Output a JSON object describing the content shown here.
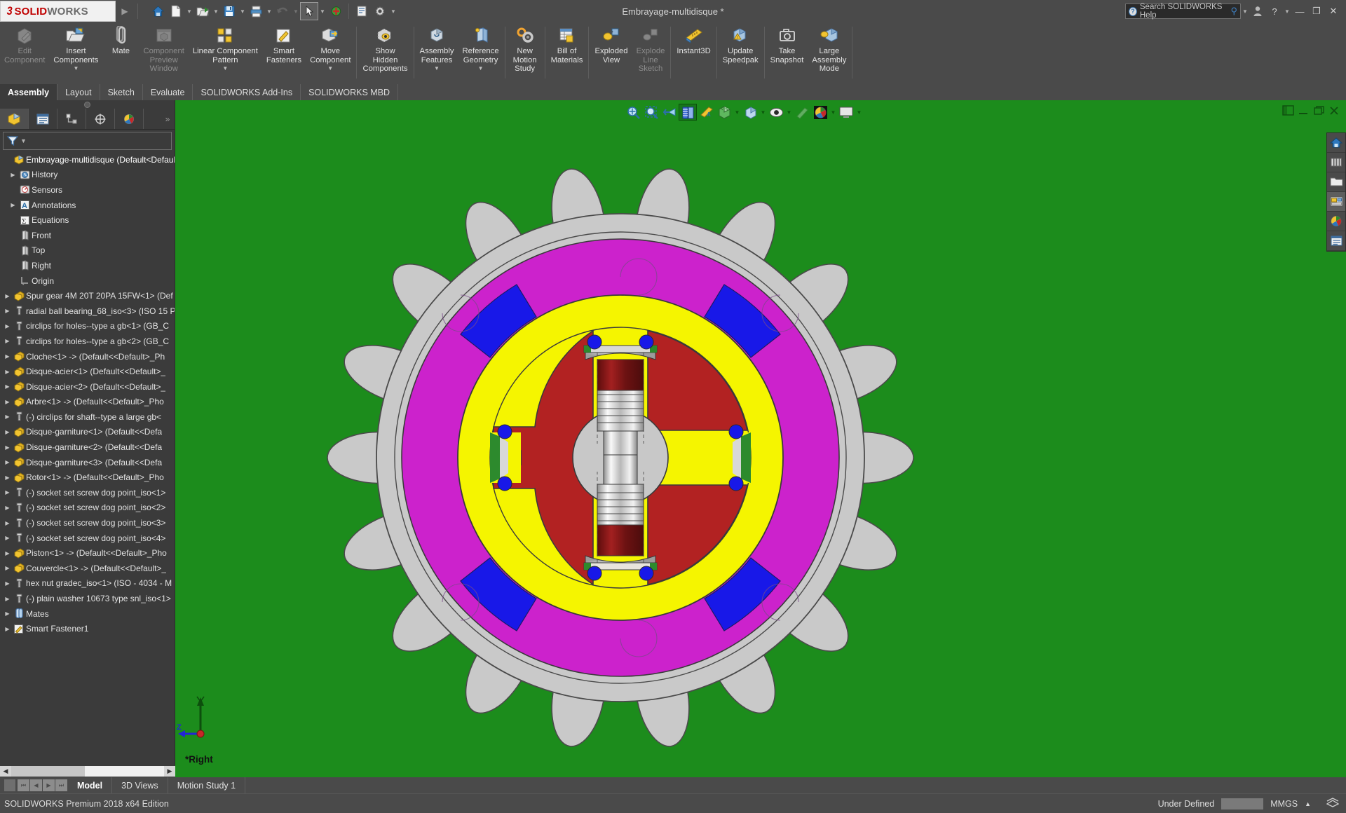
{
  "app": {
    "brand_ds": "3DS",
    "brand_solid": "SOLID",
    "brand_works": "WORKS",
    "title": "Embrayage-multidisque *",
    "edition": "SOLIDWORKS Premium 2018 x64 Edition"
  },
  "colors": {
    "viewport_green": "#1c8c1c",
    "ribbon_gray": "#4a4a4a",
    "panel_gray": "#3b3b3b",
    "accent_red": "#c00000",
    "model_magenta": "#cc22cc",
    "model_yellow": "#f5f500",
    "model_blue": "#1818e8",
    "model_red": "#b22222",
    "model_gray": "#c8c8c8",
    "model_green": "#1c8c1c"
  },
  "search": {
    "placeholder": "Search SOLIDWORKS Help",
    "value": ""
  },
  "window_controls": {
    "minimize": "—",
    "restore": "❐",
    "close": "✕",
    "help": "?",
    "profile": "user-icon"
  },
  "quick_access": [
    {
      "name": "home-icon",
      "label": "Home",
      "dropdown": false,
      "disabled": false
    },
    {
      "name": "new-document-icon",
      "label": "New",
      "dropdown": true,
      "disabled": false
    },
    {
      "name": "open-folder-icon",
      "label": "Open",
      "dropdown": true,
      "disabled": false
    },
    {
      "name": "save-icon",
      "label": "Save",
      "dropdown": true,
      "disabled": false
    },
    {
      "name": "print-icon",
      "label": "Print",
      "dropdown": true,
      "disabled": false
    },
    {
      "name": "undo-icon",
      "label": "Undo",
      "dropdown": true,
      "disabled": true
    },
    {
      "name": "select-arrow-icon",
      "label": "Select",
      "dropdown": true,
      "disabled": false,
      "selected": true
    },
    {
      "name": "rebuild-icon",
      "label": "Rebuild",
      "dropdown": false,
      "disabled": false
    },
    {
      "name": "file-properties-icon",
      "label": "File Properties",
      "dropdown": false,
      "disabled": false
    },
    {
      "name": "options-gear-icon",
      "label": "Options",
      "dropdown": true,
      "disabled": false
    }
  ],
  "ribbon": {
    "buttons": [
      {
        "label": "Edit\nComponent",
        "icon": "edit-component-icon",
        "disabled": true,
        "dropdown": false,
        "sep_after": false
      },
      {
        "label": "Insert\nComponents",
        "icon": "insert-components-icon",
        "disabled": false,
        "dropdown": true,
        "sep_after": false
      },
      {
        "label": "Mate",
        "icon": "mate-icon",
        "disabled": false,
        "dropdown": false,
        "sep_after": false
      },
      {
        "label": "Component\nPreview\nWindow",
        "icon": "component-preview-window-icon",
        "disabled": true,
        "dropdown": false,
        "sep_after": false
      },
      {
        "label": "Linear Component\nPattern",
        "icon": "linear-component-pattern-icon",
        "disabled": false,
        "dropdown": true,
        "sep_after": false
      },
      {
        "label": "Smart\nFasteners",
        "icon": "smart-fasteners-icon",
        "disabled": false,
        "dropdown": false,
        "sep_after": false
      },
      {
        "label": "Move\nComponent",
        "icon": "move-component-icon",
        "disabled": false,
        "dropdown": true,
        "sep_after": true
      },
      {
        "label": "Show\nHidden\nComponents",
        "icon": "show-hidden-components-icon",
        "disabled": false,
        "dropdown": false,
        "sep_after": true
      },
      {
        "label": "Assembly\nFeatures",
        "icon": "assembly-features-icon",
        "disabled": false,
        "dropdown": true,
        "sep_after": false
      },
      {
        "label": "Reference\nGeometry",
        "icon": "reference-geometry-icon",
        "disabled": false,
        "dropdown": true,
        "sep_after": true
      },
      {
        "label": "New\nMotion\nStudy",
        "icon": "new-motion-study-icon",
        "disabled": false,
        "dropdown": false,
        "sep_after": true
      },
      {
        "label": "Bill of\nMaterials",
        "icon": "bill-of-materials-icon",
        "disabled": false,
        "dropdown": false,
        "sep_after": true
      },
      {
        "label": "Exploded\nView",
        "icon": "exploded-view-icon",
        "disabled": false,
        "dropdown": false,
        "sep_after": false
      },
      {
        "label": "Explode\nLine\nSketch",
        "icon": "explode-line-sketch-icon",
        "disabled": true,
        "dropdown": false,
        "sep_after": true
      },
      {
        "label": "Instant3D",
        "icon": "instant3d-icon",
        "disabled": false,
        "dropdown": false,
        "sep_after": true
      },
      {
        "label": "Update\nSpeedpak",
        "icon": "update-speedpak-icon",
        "disabled": false,
        "dropdown": false,
        "sep_after": true
      },
      {
        "label": "Take\nSnapshot",
        "icon": "take-snapshot-icon",
        "disabled": false,
        "dropdown": false,
        "sep_after": false
      },
      {
        "label": "Large\nAssembly\nMode",
        "icon": "large-assembly-mode-icon",
        "disabled": false,
        "dropdown": false,
        "sep_after": true
      }
    ]
  },
  "command_tabs": [
    {
      "label": "Assembly",
      "active": true
    },
    {
      "label": "Layout",
      "active": false
    },
    {
      "label": "Sketch",
      "active": false
    },
    {
      "label": "Evaluate",
      "active": false
    },
    {
      "label": "SOLIDWORKS Add-Ins",
      "active": false
    },
    {
      "label": "SOLIDWORKS MBD",
      "active": false
    }
  ],
  "left_panel": {
    "tabs": [
      {
        "name": "feature-manager-tab",
        "icon": "yellow-cube-icon",
        "active": true
      },
      {
        "name": "property-manager-tab",
        "icon": "property-list-icon",
        "active": false
      },
      {
        "name": "configuration-manager-tab",
        "icon": "configuration-icon",
        "active": false
      },
      {
        "name": "dimxpert-manager-tab",
        "icon": "dimxpert-icon",
        "active": false
      },
      {
        "name": "display-manager-tab",
        "icon": "appearance-sphere-icon",
        "active": false
      }
    ],
    "filter_placeholder": "",
    "tree": [
      {
        "label": "Embrayage-multidisque  (Default<Default_",
        "icon": "assembly-icon",
        "expand": false,
        "indent": 0,
        "root": true
      },
      {
        "label": "History",
        "icon": "history-icon",
        "expand": true,
        "indent": 1
      },
      {
        "label": "Sensors",
        "icon": "sensors-icon",
        "expand": false,
        "indent": 1
      },
      {
        "label": "Annotations",
        "icon": "annotations-icon",
        "expand": true,
        "indent": 1
      },
      {
        "label": "Equations",
        "icon": "equations-icon",
        "expand": false,
        "indent": 1
      },
      {
        "label": "Front",
        "icon": "plane-icon",
        "expand": false,
        "indent": 1
      },
      {
        "label": "Top",
        "icon": "plane-icon",
        "expand": false,
        "indent": 1
      },
      {
        "label": "Right",
        "icon": "plane-icon",
        "expand": false,
        "indent": 1
      },
      {
        "label": "Origin",
        "icon": "origin-icon",
        "expand": false,
        "indent": 1
      },
      {
        "label": "Spur gear 4M 20T 20PA 15FW<1> (Def",
        "icon": "part-icon",
        "expand": true,
        "indent": 0
      },
      {
        "label": "radial ball bearing_68_iso<3> (ISO 15 P",
        "icon": "toolbox-icon",
        "expand": true,
        "indent": 0
      },
      {
        "label": "circlips for holes--type a gb<1>  (GB_C",
        "icon": "toolbox-icon",
        "expand": true,
        "indent": 0
      },
      {
        "label": "circlips for holes--type a gb<2>  (GB_C",
        "icon": "toolbox-icon",
        "expand": true,
        "indent": 0
      },
      {
        "label": "Cloche<1> -> (Default<<Default>_Ph",
        "icon": "part-icon",
        "expand": true,
        "indent": 0
      },
      {
        "label": "Disque-acier<1> (Default<<Default>_",
        "icon": "part-icon",
        "expand": true,
        "indent": 0
      },
      {
        "label": "Disque-acier<2> (Default<<Default>_",
        "icon": "part-icon",
        "expand": true,
        "indent": 0
      },
      {
        "label": "Arbre<1> -> (Default<<Default>_Pho",
        "icon": "part-icon",
        "expand": true,
        "indent": 0
      },
      {
        "label": "(-) circlips for shaft--type a large gb<",
        "icon": "toolbox-icon",
        "expand": true,
        "indent": 0
      },
      {
        "label": "Disque-garniture<1> (Default<<Defa",
        "icon": "part-icon",
        "expand": true,
        "indent": 0
      },
      {
        "label": "Disque-garniture<2> (Default<<Defa",
        "icon": "part-icon",
        "expand": true,
        "indent": 0
      },
      {
        "label": "Disque-garniture<3> (Default<<Defa",
        "icon": "part-icon",
        "expand": true,
        "indent": 0
      },
      {
        "label": "Rotor<1> -> (Default<<Default>_Pho",
        "icon": "part-icon",
        "expand": true,
        "indent": 0
      },
      {
        "label": "(-) socket set screw dog point_iso<1>",
        "icon": "toolbox-icon",
        "expand": true,
        "indent": 0
      },
      {
        "label": "(-) socket set screw dog point_iso<2>",
        "icon": "toolbox-icon",
        "expand": true,
        "indent": 0
      },
      {
        "label": "(-) socket set screw dog point_iso<3>",
        "icon": "toolbox-icon",
        "expand": true,
        "indent": 0
      },
      {
        "label": "(-) socket set screw dog point_iso<4>",
        "icon": "toolbox-icon",
        "expand": true,
        "indent": 0
      },
      {
        "label": "Piston<1> -> (Default<<Default>_Pho",
        "icon": "part-icon",
        "expand": true,
        "indent": 0
      },
      {
        "label": "Couvercle<1> -> (Default<<Default>_",
        "icon": "part-icon",
        "expand": true,
        "indent": 0
      },
      {
        "label": "hex nut gradec_iso<1>  (ISO - 4034 - M",
        "icon": "toolbox-icon",
        "expand": true,
        "indent": 0
      },
      {
        "label": "(-) plain washer 10673 type snl_iso<1>",
        "icon": "toolbox-icon",
        "expand": true,
        "indent": 0
      },
      {
        "label": "Mates",
        "icon": "mates-folder-icon",
        "expand": true,
        "indent": 0
      },
      {
        "label": "Smart Fastener1",
        "icon": "smart-fastener-icon",
        "expand": true,
        "indent": 0
      }
    ]
  },
  "heads_up_toolbar": [
    {
      "name": "zoom-to-fit-icon",
      "dropdown": false,
      "selected": false,
      "disabled": false
    },
    {
      "name": "zoom-to-area-icon",
      "dropdown": false,
      "selected": false,
      "disabled": false
    },
    {
      "name": "previous-view-icon",
      "dropdown": false,
      "selected": false,
      "disabled": false
    },
    {
      "name": "section-view-icon",
      "dropdown": false,
      "selected": true,
      "disabled": false
    },
    {
      "name": "view-orientation-icon",
      "dropdown": false,
      "selected": false,
      "disabled": false
    },
    {
      "name": "display-style-icon",
      "dropdown": true,
      "selected": false,
      "disabled": false
    },
    {
      "name": "hide-show-items-icon",
      "dropdown": true,
      "selected": false,
      "disabled": false
    },
    {
      "name": "edit-appearance-icon",
      "dropdown": true,
      "selected": false,
      "disabled": false
    },
    {
      "name": "apply-scene-icon",
      "dropdown": true,
      "selected": false,
      "disabled": true
    },
    {
      "name": "view-settings-icon",
      "dropdown": true,
      "selected": false,
      "disabled": false
    },
    {
      "name": "display-pane-icon",
      "dropdown": true,
      "selected": false,
      "disabled": false
    }
  ],
  "right_dock": [
    {
      "name": "design-library-home-icon",
      "selected": false
    },
    {
      "name": "design-library-icon",
      "selected": false
    },
    {
      "name": "file-explorer-icon",
      "selected": false
    },
    {
      "name": "view-palette-icon",
      "selected": true
    },
    {
      "name": "appearances-scenes-icon",
      "selected": false
    },
    {
      "name": "custom-properties-icon",
      "selected": false
    }
  ],
  "viewport": {
    "view_label": "*Right",
    "triad": {
      "x_axis": "",
      "y_axis": "",
      "z_axis": "Z"
    }
  },
  "bottom_tabs": [
    {
      "label": "Model",
      "active": true
    },
    {
      "label": "3D Views",
      "active": false
    },
    {
      "label": "Motion Study 1",
      "active": false
    }
  ],
  "status_bar": {
    "left": "SOLIDWORKS Premium 2018 x64 Edition",
    "state": "Under Defined",
    "units": "MMGS",
    "units_caret": "▲",
    "overlay_icon": "overlay-icon"
  }
}
